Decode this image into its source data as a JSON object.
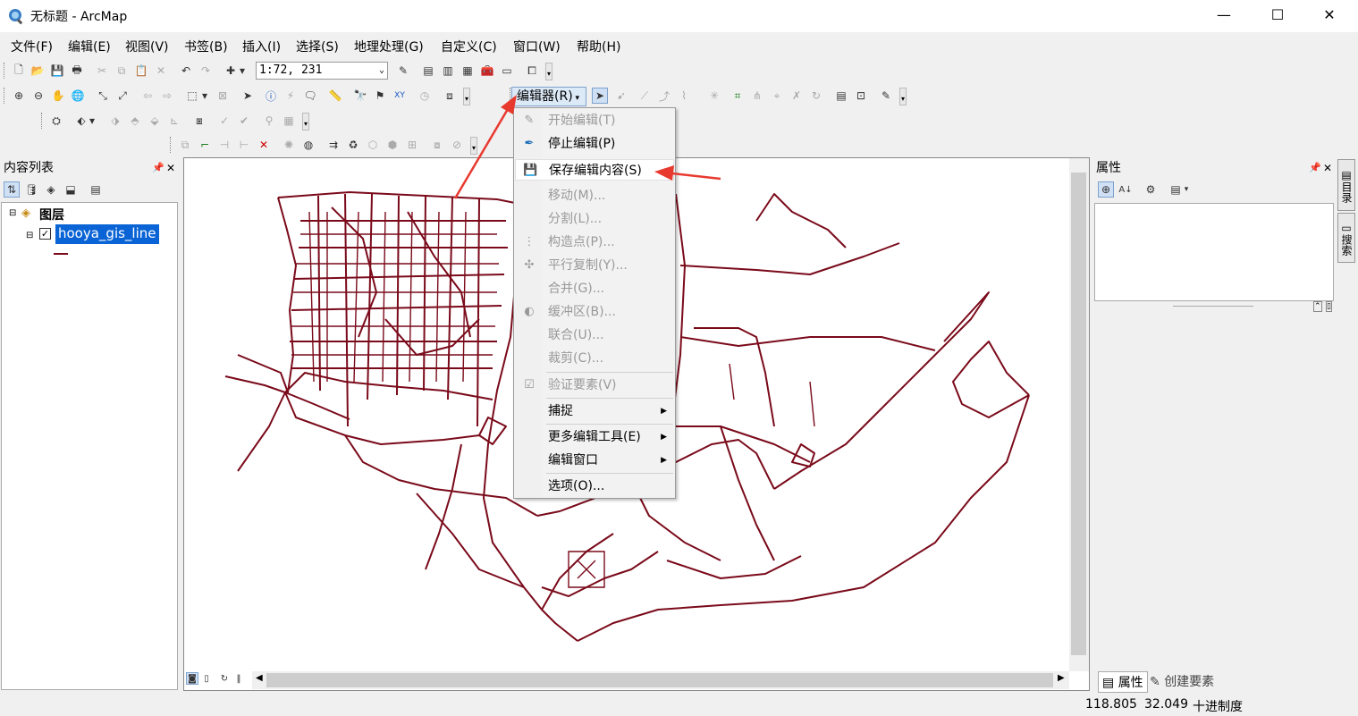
{
  "window": {
    "title": "无标题 - ArcMap",
    "minimize": "—",
    "maximize": "☐",
    "close": "✕"
  },
  "menubar": [
    "文件(F)",
    "编辑(E)",
    "视图(V)",
    "书签(B)",
    "插入(I)",
    "选择(S)",
    "地理处理(G)",
    "自定义(C)",
    "窗口(W)",
    "帮助(H)"
  ],
  "toolbar": {
    "scale": "1:72, 231",
    "editor_label": "编辑器(R)"
  },
  "toc": {
    "title": "内容列表",
    "layers_label": "图层",
    "layer_name": "hooya_gis_line",
    "layer_checked": true,
    "line_color": "#7a0a1a"
  },
  "properties": {
    "title": "属性",
    "tab_properties": "属性",
    "tab_create": "创建要素"
  },
  "side_tabs": [
    "目录",
    "搜索"
  ],
  "editor_menu": {
    "items": [
      {
        "label": "开始编辑(T)",
        "enabled": false,
        "icon": "pencil-icon"
      },
      {
        "label": "停止编辑(P)",
        "enabled": true,
        "icon": "stop-edit-icon"
      },
      {
        "label": "保存编辑内容(S)",
        "enabled": true,
        "icon": "save-edits-icon"
      },
      {
        "label": "移动(M)...",
        "enabled": false
      },
      {
        "label": "分割(L)...",
        "enabled": false
      },
      {
        "label": "构造点(P)...",
        "enabled": false,
        "icon": "construct-points-icon"
      },
      {
        "label": "平行复制(Y)...",
        "enabled": false,
        "icon": "copy-parallel-icon"
      },
      {
        "label": "合并(G)...",
        "enabled": false
      },
      {
        "label": "缓冲区(B)...",
        "enabled": false,
        "icon": "buffer-icon"
      },
      {
        "label": "联合(U)...",
        "enabled": false
      },
      {
        "label": "裁剪(C)...",
        "enabled": false
      },
      {
        "label": "验证要素(V)",
        "enabled": false,
        "icon": "validate-icon"
      },
      {
        "label": "捕捉",
        "enabled": true,
        "submenu": true
      },
      {
        "label": "更多编辑工具(E)",
        "enabled": true,
        "submenu": true
      },
      {
        "label": "编辑窗口",
        "enabled": true,
        "submenu": true
      },
      {
        "label": "选项(O)...",
        "enabled": true
      }
    ]
  },
  "status": {
    "x": "118.805",
    "y": "32.049",
    "units": "十进制度"
  },
  "colors": {
    "road": "#7a0a1a",
    "arrow": "#e8392f",
    "selection": "#0a64d6"
  }
}
